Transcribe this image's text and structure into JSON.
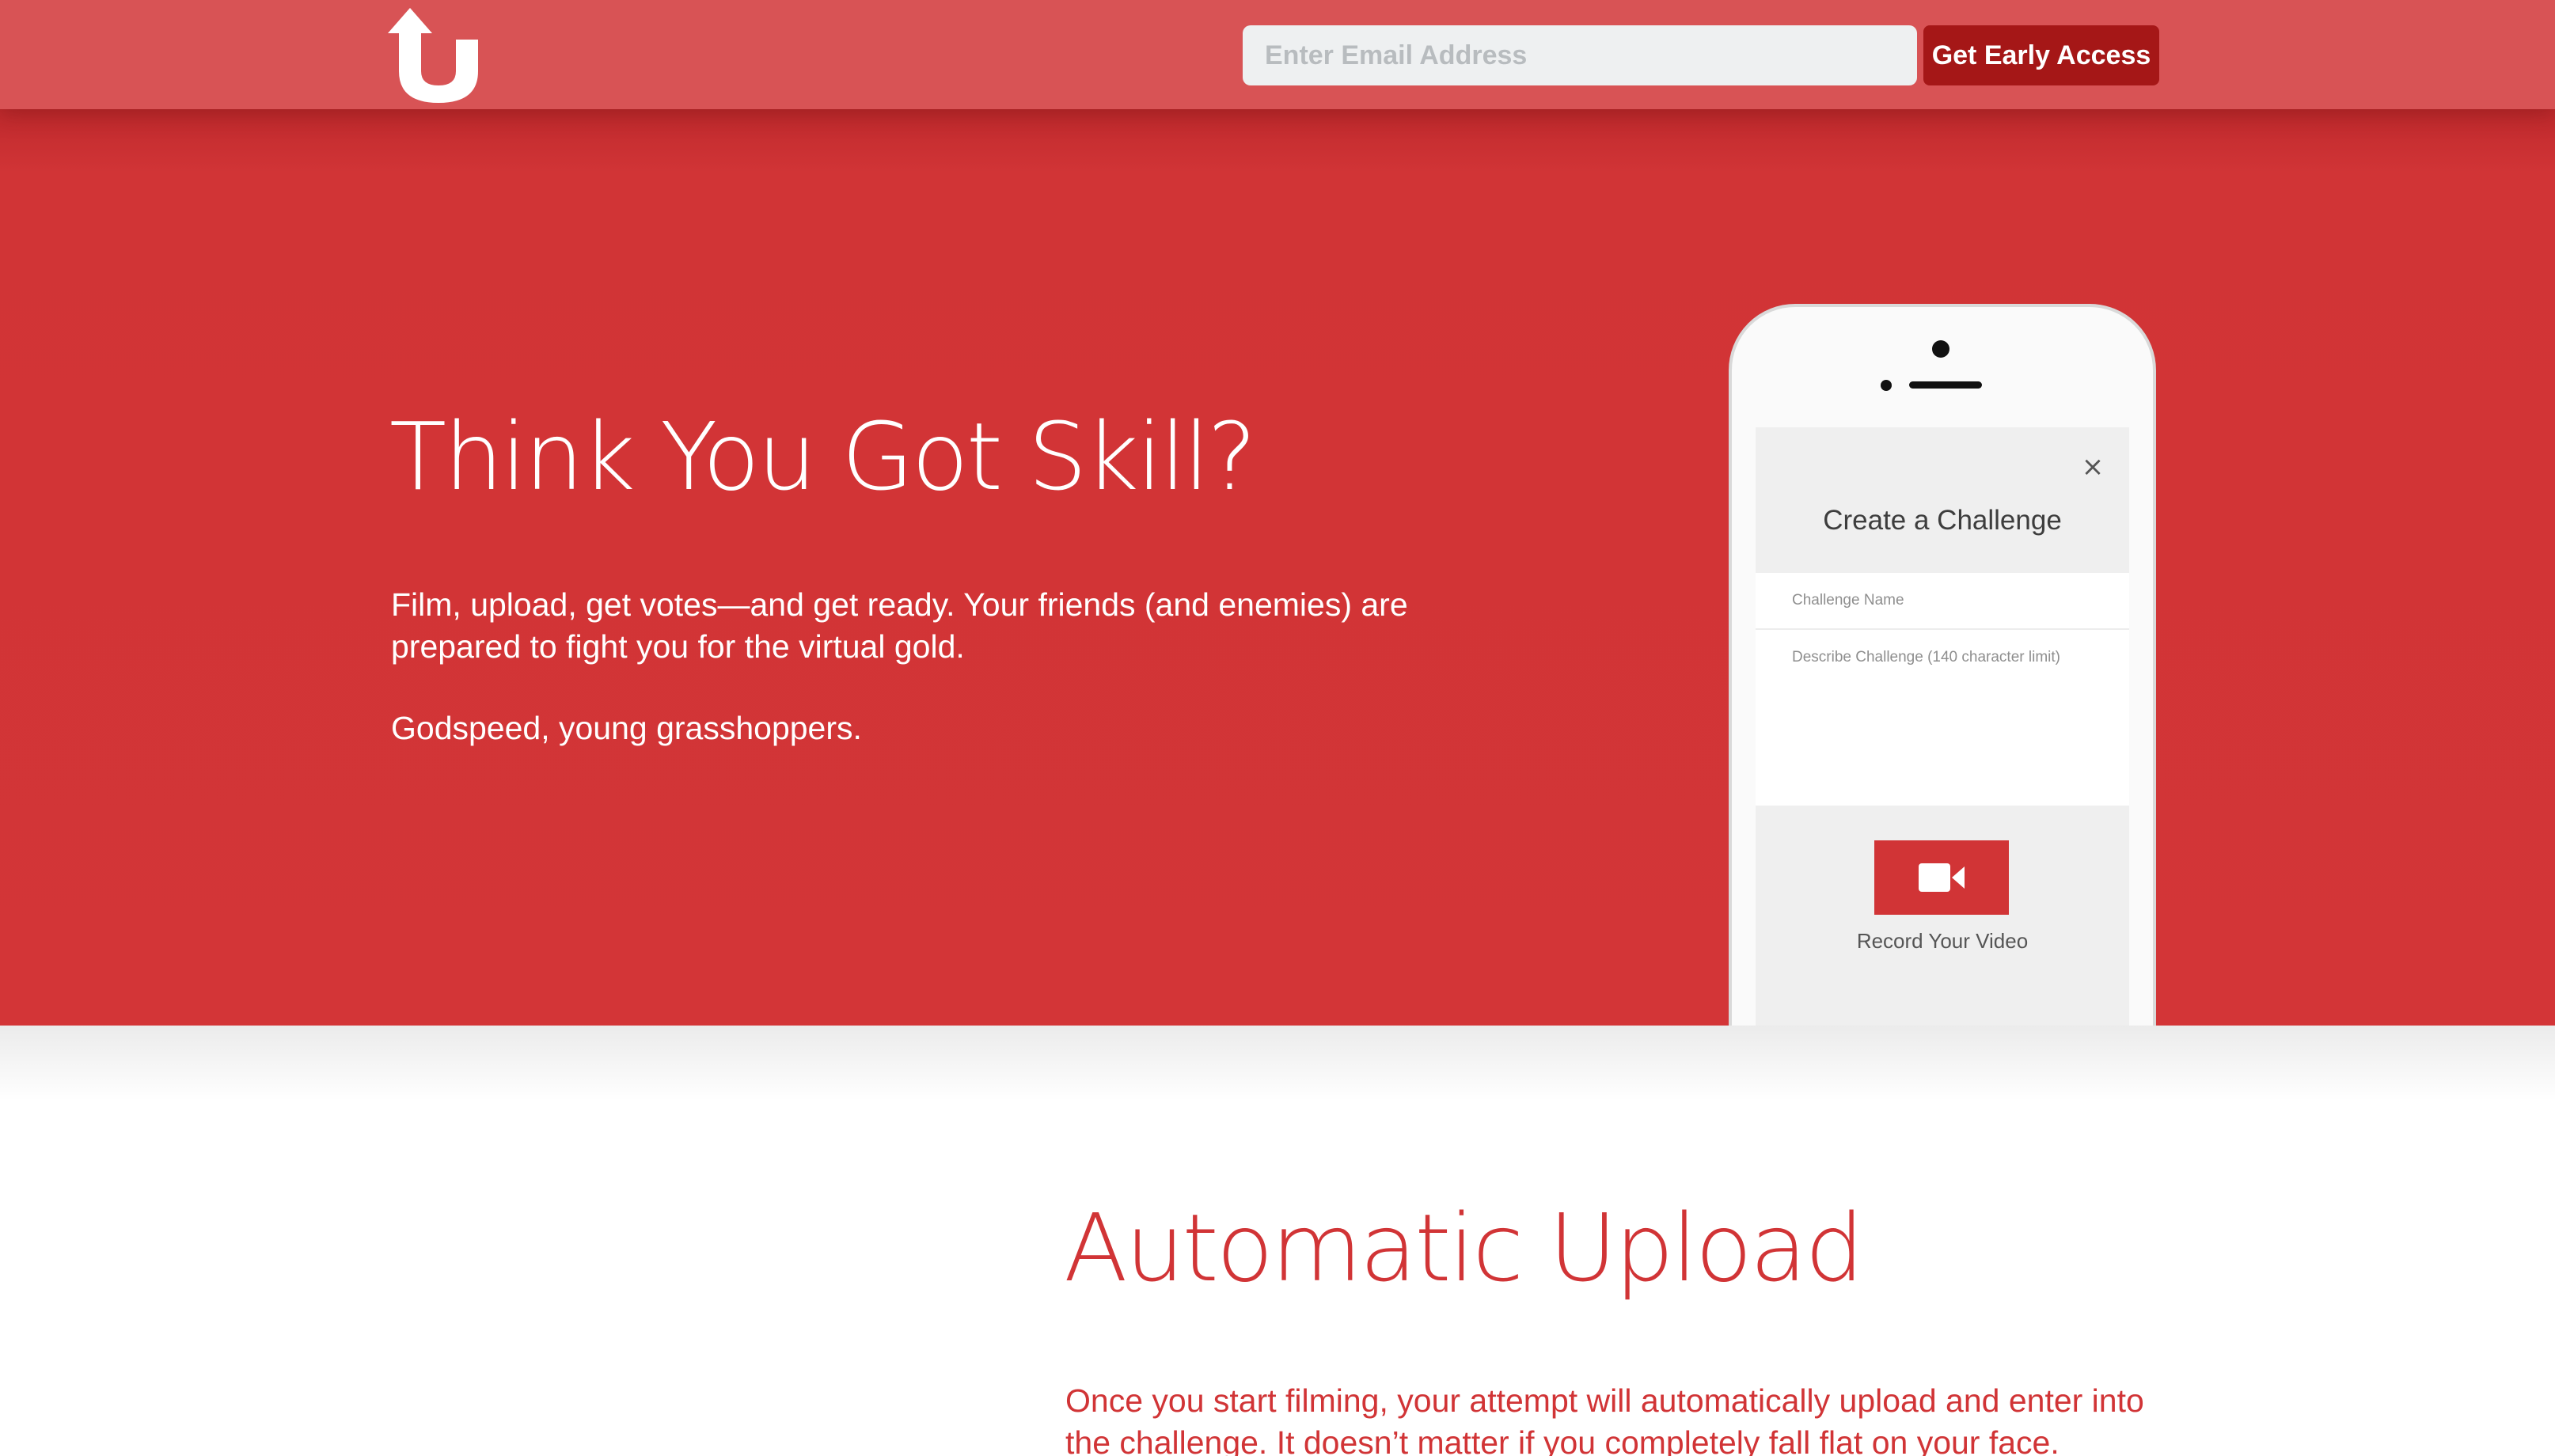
{
  "header": {
    "email_placeholder": "Enter Email Address",
    "cta_label": "Get Early Access",
    "logo_icon": "upload-arrow-u-logo"
  },
  "hero": {
    "title": "Think You Got Skill?",
    "paragraph": "Film, upload, get votes—and get ready. Your friends (and enemies) are prepared to fight you for the virtual gold.",
    "tagline": "Godspeed, young grasshoppers."
  },
  "phone_screen": {
    "close_icon": "×",
    "title": "Create a Challenge",
    "name_placeholder": "Challenge Name",
    "description_placeholder": "Describe Challenge (140 character limit)",
    "record_icon": "video-camera-icon",
    "record_label": "Record Your Video"
  },
  "feature": {
    "title": "Automatic Upload",
    "text": "Once you start filming, your attempt will automatically upload and enter into the challenge. It doesn’t matter if you completely fall flat on your face."
  },
  "colors": {
    "header_bg": "#d85355",
    "hero_bg": "#d33537",
    "cta_bg": "#a51717",
    "accent_text": "#d13436"
  }
}
